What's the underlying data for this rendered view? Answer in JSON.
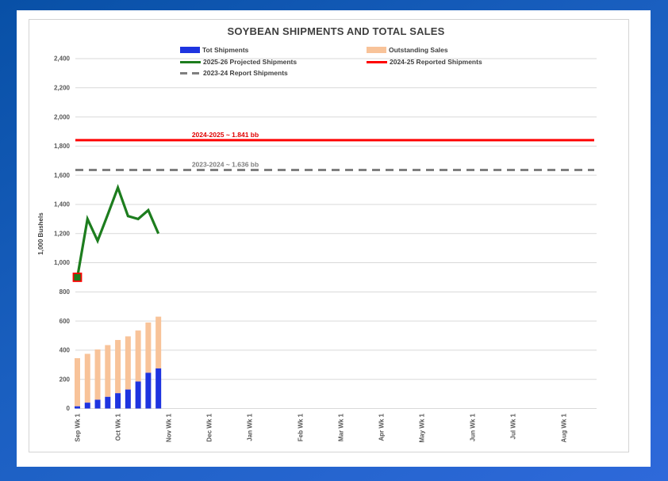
{
  "chart_data": {
    "type": "combo",
    "title": "SOYBEAN SHIPMENTS AND TOTAL SALES",
    "y_axis": {
      "label": "1,000 Bushels",
      "min": 0,
      "max": 2400,
      "step": 200,
      "tick_labels": [
        "0",
        "200",
        "400",
        "600",
        "800",
        "1,000",
        "1,200",
        "1,400",
        "1,600",
        "1,800",
        "2,000",
        "2,200",
        "2,400"
      ]
    },
    "x_axis": {
      "tick_labels": [
        "Sep Wk 1",
        "Oct Wk 1",
        "Nov Wk 1",
        "Dec Wk 1",
        "Jan Wk 1",
        "Feb Wk 1",
        "Mar Wk 1",
        "Apr Wk 1",
        "May Wk 1",
        "Jun Wk 1",
        "Jul Wk 1",
        "Aug Wk 1"
      ],
      "tick_week_index": [
        0,
        4,
        9,
        13,
        17,
        22,
        26,
        30,
        34,
        39,
        43,
        48
      ],
      "total_weeks": 52
    },
    "bar_categories": [
      "Sep Wk 1",
      "Sep Wk 2",
      "Sep Wk 3",
      "Sep Wk 4",
      "Oct Wk 1",
      "Oct Wk 2",
      "Oct Wk 3",
      "Oct Wk 4",
      "Oct Wk 5"
    ],
    "series": [
      {
        "name": "Tot Shipments",
        "type": "bar",
        "color": "#1e34e0",
        "values": [
          15,
          40,
          60,
          80,
          105,
          130,
          185,
          245,
          275
        ]
      },
      {
        "name": "Outstanding Sales",
        "type": "bar",
        "stacked_on": "Tot Shipments",
        "color": "#f8c399",
        "values": [
          330,
          335,
          345,
          355,
          365,
          365,
          350,
          345,
          355
        ]
      },
      {
        "name": "2025-26 Projected Shipments",
        "type": "line",
        "color": "#1d7d1e",
        "values": [
          900,
          1300,
          1150,
          1330,
          1515,
          1320,
          1300,
          1360,
          1200
        ],
        "first_point_marker": {
          "shape": "square",
          "fill": "#1d7d1e",
          "border": "#ff0000"
        }
      },
      {
        "name": "2024-25 Reported Shipments",
        "type": "hline",
        "dashed": false,
        "color": "#fe0000",
        "value": 1841,
        "annotation": "2024-2025 ~ 1.841 bb"
      },
      {
        "name": "2023-24 Report Shipments",
        "type": "hline",
        "dashed": true,
        "color": "#7f7f7f",
        "value": 1636,
        "annotation": "2023-2024 ~ 1.636 bb"
      }
    ],
    "legend_position": "top-two-columns",
    "grid": true
  },
  "colors": {
    "background_top": "#0850a6",
    "background_bottom": "#2e69da",
    "panel": "#ffffff",
    "chart_border": "#d4d4d4",
    "gridline": "#d9d9d9",
    "axis_text": "#595959",
    "title_text": "#3f3f3f",
    "annotation_red": "#e00000",
    "annotation_gray": "#7f7f7f"
  }
}
